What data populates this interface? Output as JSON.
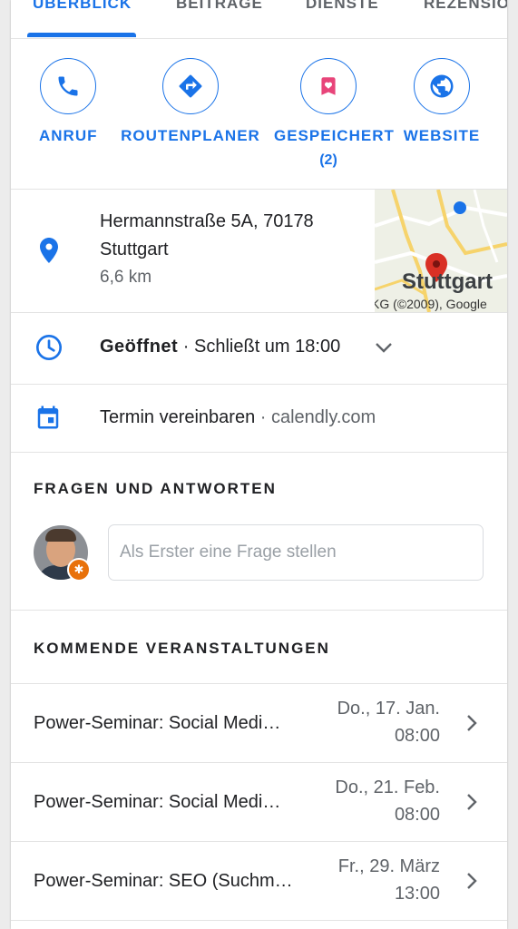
{
  "tabs": [
    {
      "label": "ÜBERBLICK",
      "active": true
    },
    {
      "label": "BEITRÄGE",
      "active": false
    },
    {
      "label": "DIENSTE",
      "active": false
    },
    {
      "label": "REZENSIO",
      "active": false
    }
  ],
  "actions": [
    {
      "label": "ANRUF",
      "icon": "phone-icon"
    },
    {
      "label": "ROUTENPLANER",
      "icon": "directions-icon"
    },
    {
      "label": "GESPEICHERT",
      "sub": "(2)",
      "icon": "bookmark-icon"
    },
    {
      "label": "WEBSITE",
      "icon": "globe-icon"
    }
  ],
  "address": {
    "line1": "Hermannstraße 5A, 70178",
    "line2": "Stuttgart",
    "distance": "6,6 km",
    "map_city": "Stuttgart",
    "map_copyright": "KG (©2009), Google"
  },
  "hours": {
    "status": "Geöffnet",
    "separator": " · ",
    "closes": "Schließt um 18:00"
  },
  "booking": {
    "label": "Termin vereinbaren",
    "separator": " · ",
    "site": "calendly.com"
  },
  "qa": {
    "title": "FRAGEN UND ANTWORTEN",
    "placeholder": "Als Erster eine Frage stellen"
  },
  "events": {
    "title": "KOMMENDE VERANSTALTUNGEN",
    "items": [
      {
        "title": "Power-Seminar: Social Medi…",
        "date": "Do., 17. Jan.",
        "time": "08:00"
      },
      {
        "title": "Power-Seminar: Social Medi…",
        "date": "Do., 21. Feb.",
        "time": "08:00"
      },
      {
        "title": "Power-Seminar: SEO (Suchm…",
        "date": "Fr., 29. März",
        "time": "13:00"
      }
    ]
  },
  "colors": {
    "accent": "#1a73e8",
    "bookmark": "#e8457a",
    "map_pin": "#d93025"
  }
}
